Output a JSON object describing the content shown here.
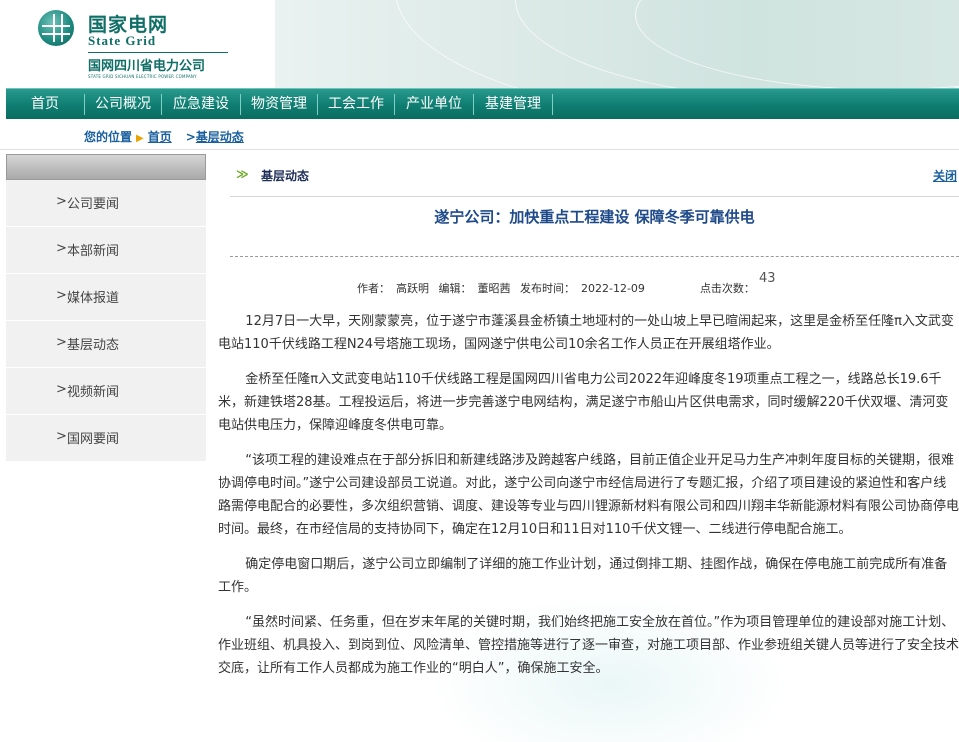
{
  "brand": {
    "name_cn": "国家电网",
    "name_en": "State Grid",
    "company_cn": "国网四川省电力公司",
    "company_en": "STATE GRID SICHUAN ELECTRIC POWER COMPANY",
    "color": "#0f6e66"
  },
  "nav": {
    "items": [
      "首页",
      "公司概况",
      "应急建设",
      "物资管理",
      "工会工作",
      "产业单位",
      "基建管理"
    ]
  },
  "breadcrumb": {
    "label": "您的位置",
    "home": "首页",
    "current": "基层动态"
  },
  "sidebar": {
    "items": [
      "公司要闻",
      "本部新闻",
      "媒体报道",
      "基层动态",
      "视频新闻",
      "国网要闻"
    ]
  },
  "section": {
    "title": "基层动态",
    "more": "关闭"
  },
  "article": {
    "title": "遂宁公司：加快重点工程建设 保障冬季可靠供电",
    "author_label": "作者：",
    "author": "高跃明",
    "editor_label": "编辑：",
    "editor": "董昭茜",
    "date_label": "发布时间：",
    "date": "2022-12-09",
    "hits_label": "点击次数：",
    "hits": "43",
    "paragraphs": [
      "12月7日一大早，天刚蒙蒙亮，位于遂宁市蓬溪县金桥镇土地垭村的一处山坡上早已暄闹起来，这里是金桥至任隆π入文武变电站110千伏线路工程N24号塔施工现场，国网遂宁供电公司10余名工作人员正在开展组塔作业。",
      "金桥至任隆π入文武变电站110千伏线路工程是国网四川省电力公司2022年迎峰度冬19项重点工程之一，线路总长19.6千米，新建铁塔28基。工程投运后，将进一步完善遂宁电网结构，满足遂宁市船山片区供电需求，同时缓解220千伏双堰、清河变电站供电压力，保障迎峰度冬供电可靠。",
      "“该项工程的建设难点在于部分拆旧和新建线路涉及跨越客户线路，目前正值企业开足马力生产冲刺年度目标的关键期，很难协调停电时间。”遂宁公司建设部员工说道。对此，遂宁公司向遂宁市经信局进行了专题汇报，介绍了项目建设的紧迫性和客户线路需停电配合的必要性，多次组织营销、调度、建设等专业与四川锂源新材料有限公司和四川翔丰华新能源材料有限公司协商停电时间。最终，在市经信局的支持协同下，确定在12月10日和11日对110千伏文锂一、二线进行停电配合施工。",
      "确定停电窗口期后，遂宁公司立即编制了详细的施工作业计划，通过倒排工期、挂图作战，确保在停电施工前完成所有准备工作。",
      "“虽然时间紧、任务重，但在岁末年尾的关键时期，我们始终把施工安全放在首位。”作为项目管理单位的建设部对施工计划、作业班组、机具投入、到岗到位、风险清单、管控措施等进行了逐一审查，对施工项目部、作业参班组关键人员等进行了安全技术交底，让所有工作人员都成为施工作业的“明白人”，确保施工安全。"
    ]
  },
  "colors": {
    "nav": "#0f7d71",
    "link": "#1a5f9e",
    "title": "#1f4a8a",
    "accent": "#e8a400"
  }
}
